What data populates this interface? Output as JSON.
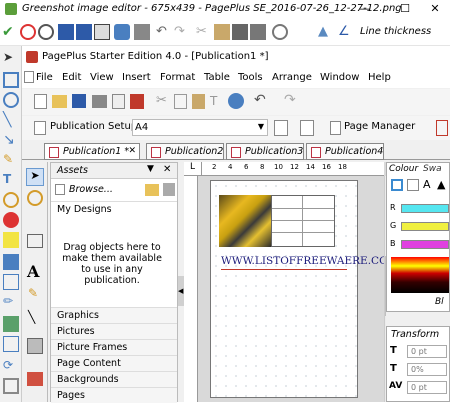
{
  "window": {
    "title": "Greenshot image editor - 675x439 - PagePlus SE_2016-07-26_12-27-12.png",
    "minimize": "—",
    "maximize": "☐",
    "close": "✕"
  },
  "greenshot_toolbar": {
    "line_thickness_label": "Line thickness"
  },
  "app": {
    "title": "PagePlus Starter Edition 4.0 - [Publication1 *]",
    "menu": [
      "File",
      "Edit",
      "View",
      "Insert",
      "Format",
      "Table",
      "Tools",
      "Arrange",
      "Window",
      "Help"
    ],
    "publication_setup_label": "Publication Setup",
    "page_size": "A4",
    "page_manager_label": "Page Manager",
    "tabs": [
      "Publication1 *",
      "Publication2",
      "Publication3",
      "Publication4"
    ]
  },
  "assets": {
    "tab_label": "Assets",
    "browse_label": "Browse...",
    "my_designs": "My Designs",
    "drop_hint": "Drag objects here to make them available to use in any publication.",
    "categories": [
      "Graphics",
      "Pictures",
      "Picture Frames",
      "Page Content",
      "Backgrounds",
      "Pages"
    ]
  },
  "canvas": {
    "ruler_marks": [
      "2",
      "4",
      "6",
      "8",
      "10",
      "12",
      "14",
      "16",
      "18"
    ],
    "watermark_text": "WWW.LISTOFFREEWAERE.COM"
  },
  "colour_panel": {
    "tab_colour": "Colour",
    "tab_swatches": "Swa",
    "labels": [
      "R",
      "G",
      "B"
    ],
    "colors": {
      "r": "#55e6f0",
      "g": "#f0f040",
      "b": "#e040e0"
    },
    "footer": "Bl"
  },
  "transform_panel": {
    "title": "Transform",
    "fields": [
      "0 pt",
      "0%",
      "0 pt"
    ]
  }
}
